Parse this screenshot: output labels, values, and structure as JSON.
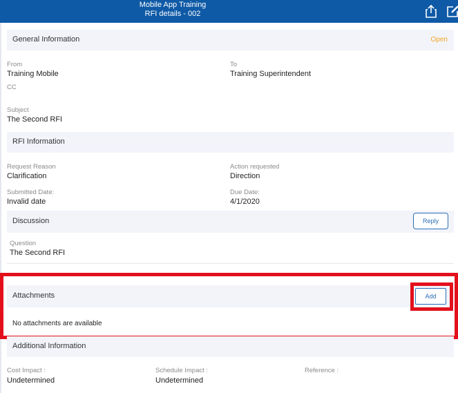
{
  "header": {
    "app_title": "Mobile App Training",
    "page_title": "RFI details - 002"
  },
  "general": {
    "section_label": "General Information",
    "status": "Open",
    "from_label": "From",
    "from_value": "Training Mobile",
    "to_label": "To",
    "to_value": "Training Superintendent",
    "cc_label": "CC",
    "subject_label": "Subject",
    "subject_value": "The Second RFI"
  },
  "rfi": {
    "section_label": "RFI Information",
    "reason_label": "Request Reason",
    "reason_value": "Clarification",
    "action_label": "Action requested",
    "action_value": "Direction",
    "submitted_label": "Submitted Date:",
    "submitted_value": "Invalid date",
    "due_label": "Due Date:",
    "due_value": "4/1/2020"
  },
  "discussion": {
    "section_label": "Discussion",
    "reply_label": "Reply",
    "question_label": "Question",
    "question_value": "The Second RFI"
  },
  "attachments": {
    "section_label": "Attachments",
    "add_label": "Add",
    "empty_text": "No attachments are available"
  },
  "additional": {
    "section_label": "Additional Information",
    "cost_label": "Cost Impact :",
    "cost_value": "Undetermined",
    "schedule_label": "Schedule Impact :",
    "schedule_value": "Undetermined",
    "reference_label": "Reference :"
  },
  "colors": {
    "header_bg": "#0f5aa6",
    "section_bg": "#f2f4fa",
    "status_open": "#f5a623",
    "button_accent": "#2a6db5",
    "highlight": "#e3101c"
  }
}
